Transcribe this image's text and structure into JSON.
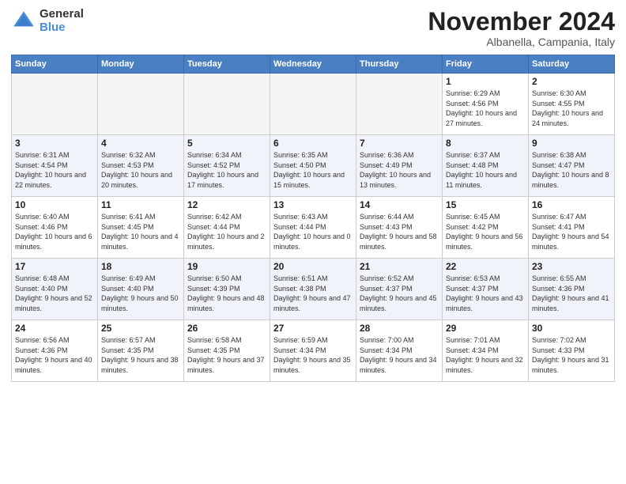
{
  "logo": {
    "line1": "General",
    "line2": "Blue"
  },
  "title": "November 2024",
  "location": "Albanella, Campania, Italy",
  "weekdays": [
    "Sunday",
    "Monday",
    "Tuesday",
    "Wednesday",
    "Thursday",
    "Friday",
    "Saturday"
  ],
  "weeks": [
    [
      {
        "day": "",
        "info": ""
      },
      {
        "day": "",
        "info": ""
      },
      {
        "day": "",
        "info": ""
      },
      {
        "day": "",
        "info": ""
      },
      {
        "day": "",
        "info": ""
      },
      {
        "day": "1",
        "info": "Sunrise: 6:29 AM\nSunset: 4:56 PM\nDaylight: 10 hours and 27 minutes."
      },
      {
        "day": "2",
        "info": "Sunrise: 6:30 AM\nSunset: 4:55 PM\nDaylight: 10 hours and 24 minutes."
      }
    ],
    [
      {
        "day": "3",
        "info": "Sunrise: 6:31 AM\nSunset: 4:54 PM\nDaylight: 10 hours and 22 minutes."
      },
      {
        "day": "4",
        "info": "Sunrise: 6:32 AM\nSunset: 4:53 PM\nDaylight: 10 hours and 20 minutes."
      },
      {
        "day": "5",
        "info": "Sunrise: 6:34 AM\nSunset: 4:52 PM\nDaylight: 10 hours and 17 minutes."
      },
      {
        "day": "6",
        "info": "Sunrise: 6:35 AM\nSunset: 4:50 PM\nDaylight: 10 hours and 15 minutes."
      },
      {
        "day": "7",
        "info": "Sunrise: 6:36 AM\nSunset: 4:49 PM\nDaylight: 10 hours and 13 minutes."
      },
      {
        "day": "8",
        "info": "Sunrise: 6:37 AM\nSunset: 4:48 PM\nDaylight: 10 hours and 11 minutes."
      },
      {
        "day": "9",
        "info": "Sunrise: 6:38 AM\nSunset: 4:47 PM\nDaylight: 10 hours and 8 minutes."
      }
    ],
    [
      {
        "day": "10",
        "info": "Sunrise: 6:40 AM\nSunset: 4:46 PM\nDaylight: 10 hours and 6 minutes."
      },
      {
        "day": "11",
        "info": "Sunrise: 6:41 AM\nSunset: 4:45 PM\nDaylight: 10 hours and 4 minutes."
      },
      {
        "day": "12",
        "info": "Sunrise: 6:42 AM\nSunset: 4:44 PM\nDaylight: 10 hours and 2 minutes."
      },
      {
        "day": "13",
        "info": "Sunrise: 6:43 AM\nSunset: 4:44 PM\nDaylight: 10 hours and 0 minutes."
      },
      {
        "day": "14",
        "info": "Sunrise: 6:44 AM\nSunset: 4:43 PM\nDaylight: 9 hours and 58 minutes."
      },
      {
        "day": "15",
        "info": "Sunrise: 6:45 AM\nSunset: 4:42 PM\nDaylight: 9 hours and 56 minutes."
      },
      {
        "day": "16",
        "info": "Sunrise: 6:47 AM\nSunset: 4:41 PM\nDaylight: 9 hours and 54 minutes."
      }
    ],
    [
      {
        "day": "17",
        "info": "Sunrise: 6:48 AM\nSunset: 4:40 PM\nDaylight: 9 hours and 52 minutes."
      },
      {
        "day": "18",
        "info": "Sunrise: 6:49 AM\nSunset: 4:40 PM\nDaylight: 9 hours and 50 minutes."
      },
      {
        "day": "19",
        "info": "Sunrise: 6:50 AM\nSunset: 4:39 PM\nDaylight: 9 hours and 48 minutes."
      },
      {
        "day": "20",
        "info": "Sunrise: 6:51 AM\nSunset: 4:38 PM\nDaylight: 9 hours and 47 minutes."
      },
      {
        "day": "21",
        "info": "Sunrise: 6:52 AM\nSunset: 4:37 PM\nDaylight: 9 hours and 45 minutes."
      },
      {
        "day": "22",
        "info": "Sunrise: 6:53 AM\nSunset: 4:37 PM\nDaylight: 9 hours and 43 minutes."
      },
      {
        "day": "23",
        "info": "Sunrise: 6:55 AM\nSunset: 4:36 PM\nDaylight: 9 hours and 41 minutes."
      }
    ],
    [
      {
        "day": "24",
        "info": "Sunrise: 6:56 AM\nSunset: 4:36 PM\nDaylight: 9 hours and 40 minutes."
      },
      {
        "day": "25",
        "info": "Sunrise: 6:57 AM\nSunset: 4:35 PM\nDaylight: 9 hours and 38 minutes."
      },
      {
        "day": "26",
        "info": "Sunrise: 6:58 AM\nSunset: 4:35 PM\nDaylight: 9 hours and 37 minutes."
      },
      {
        "day": "27",
        "info": "Sunrise: 6:59 AM\nSunset: 4:34 PM\nDaylight: 9 hours and 35 minutes."
      },
      {
        "day": "28",
        "info": "Sunrise: 7:00 AM\nSunset: 4:34 PM\nDaylight: 9 hours and 34 minutes."
      },
      {
        "day": "29",
        "info": "Sunrise: 7:01 AM\nSunset: 4:34 PM\nDaylight: 9 hours and 32 minutes."
      },
      {
        "day": "30",
        "info": "Sunrise: 7:02 AM\nSunset: 4:33 PM\nDaylight: 9 hours and 31 minutes."
      }
    ]
  ]
}
